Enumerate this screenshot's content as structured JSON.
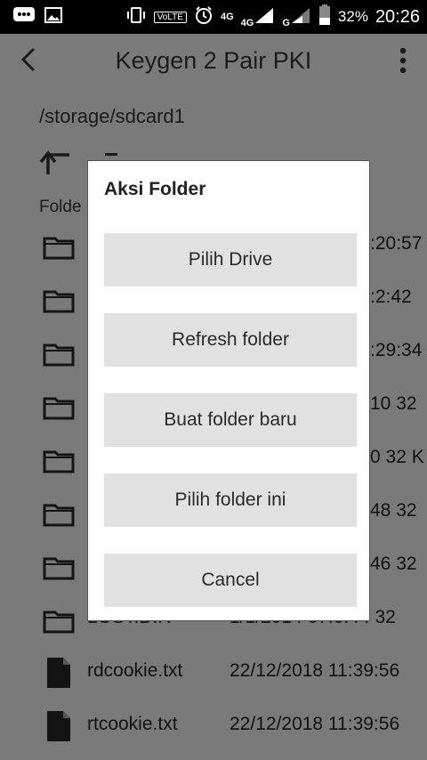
{
  "status_bar": {
    "volte": "VoLTE",
    "net1": "4G",
    "net1_badge": "4G",
    "net2": "G",
    "battery": "32%",
    "time": "20:26"
  },
  "app_bar": {
    "title": "Keygen 2 Pair PKI"
  },
  "browser": {
    "path": "/storage/sdcard1",
    "folders_label": "Folde",
    "items": [
      {
        "type": "folder",
        "name": "",
        "meta": ":20:57"
      },
      {
        "type": "folder",
        "name": "",
        "meta": ":2:42"
      },
      {
        "type": "folder",
        "name": "",
        "meta": ":29:34"
      },
      {
        "type": "folder",
        "name": "",
        "meta": "10  32"
      },
      {
        "type": "folder",
        "name": "",
        "meta": "0  32 K"
      },
      {
        "type": "folder",
        "name": "",
        "meta": "48  32"
      },
      {
        "type": "folder",
        "name": "",
        "meta": "46  32"
      },
      {
        "type": "folder",
        "name": "LOST.DIR",
        "meta": "1/1/2014 07:0:44  32"
      },
      {
        "type": "file",
        "name": "rdcookie.txt",
        "meta": "22/12/2018 11:39:56"
      },
      {
        "type": "file",
        "name": "rtcookie.txt",
        "meta": "22/12/2018 11:39:56"
      }
    ]
  },
  "dialog": {
    "title": "Aksi Folder",
    "buttons": [
      "Pilih Drive",
      "Refresh folder",
      "Buat folder baru",
      "Pilih folder ini",
      "Cancel"
    ]
  }
}
